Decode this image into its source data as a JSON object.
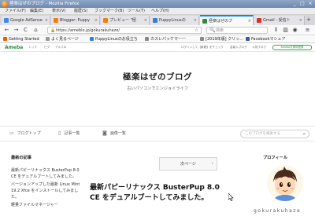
{
  "window": {
    "title": "極楽はぜのブログ - Mozilla Firefox",
    "controls": [
      "_",
      "□",
      "×"
    ]
  },
  "menu": [
    "ファイル(F)",
    "編集(E)",
    "表示(V)",
    "履歴(S)",
    "ブックマーク(B)",
    "ツール(T)",
    "ヘルプ(H)"
  ],
  "tabs": [
    {
      "label": "Google AdSense",
      "favicon_color": "#4285f4",
      "active": false
    },
    {
      "label": "Blogger: Puppy",
      "favicon_color": "#f57d00",
      "active": false
    },
    {
      "label": "プレビュー \"極",
      "favicon_color": "#f57d00",
      "active": false
    },
    {
      "label": "PuppyLinuxの",
      "favicon_color": "#3a7bd5",
      "active": false
    },
    {
      "label": "極楽はぜのブ",
      "favicon_color": "#2d8c3c",
      "active": true
    },
    {
      "label": "Gmail - 受信ト",
      "favicon_color": "#d93025",
      "active": false
    }
  ],
  "tab_close": "×",
  "tab_new": "+",
  "nav": {
    "url": "https://ameblo.jp/gokurakuhaze/",
    "search_placeholder": "検索",
    "back": "←",
    "forward": "→",
    "reload": "C",
    "home": "⌂",
    "lock": "🔒",
    "star": "☆",
    "search_icon": "🔍"
  },
  "bookmarks": [
    {
      "label": "Getting Started",
      "color": "#e66000"
    },
    {
      "label": "よく見るページ",
      "color": "#999999"
    },
    {
      "label": "PuppyLinuxのお役立ち",
      "color": "#3a7bd5"
    },
    {
      "label": "カスレパッケマーー",
      "color": "#888888"
    },
    {
      "label": "[2019年版] クリッ...",
      "color": "#888888"
    },
    {
      "label": "Facebookマシェア",
      "color": "#3b5998"
    }
  ],
  "ameba": {
    "logo": "Ameba",
    "nav": [
      "トップ",
      "ピグ",
      "アメブロ"
    ],
    "right": [
      "ログインして【新着】をチェック",
      "芸能人ブログ",
      "人気ブログ"
    ],
    "login": "Amebaを無料登録"
  },
  "blog": {
    "title": "極楽はぜのブログ",
    "subtitle": "古いパソコンでエンジョイライフ",
    "nav": [
      {
        "label": "ブログトップ",
        "icon": "blog-top-icon"
      },
      {
        "label": "記事一覧",
        "icon": "article-list-icon"
      },
      {
        "label": "画像一覧",
        "icon": "camera-icon"
      }
    ],
    "search_placeholder": "このブログを検索する"
  },
  "sidebar": {
    "heading": "最新の記事",
    "items": [
      "最新パピーリナックス BusterPup 8.0 CE をデュアルブートしてみました。",
      "バージョンアップした最新 Linux Mint 19.2 Xfce をインストールしてみました。",
      "軽量ファイルマネージャー"
    ]
  },
  "main": {
    "next_label": "次ページ",
    "next_arrow": "›",
    "post_title": "最新パピーリナックス BusterPup 8.0 CE をデュアルブートしてみました。"
  },
  "profile": {
    "heading": "プロフィール",
    "handle": "gokurakuhaze"
  }
}
